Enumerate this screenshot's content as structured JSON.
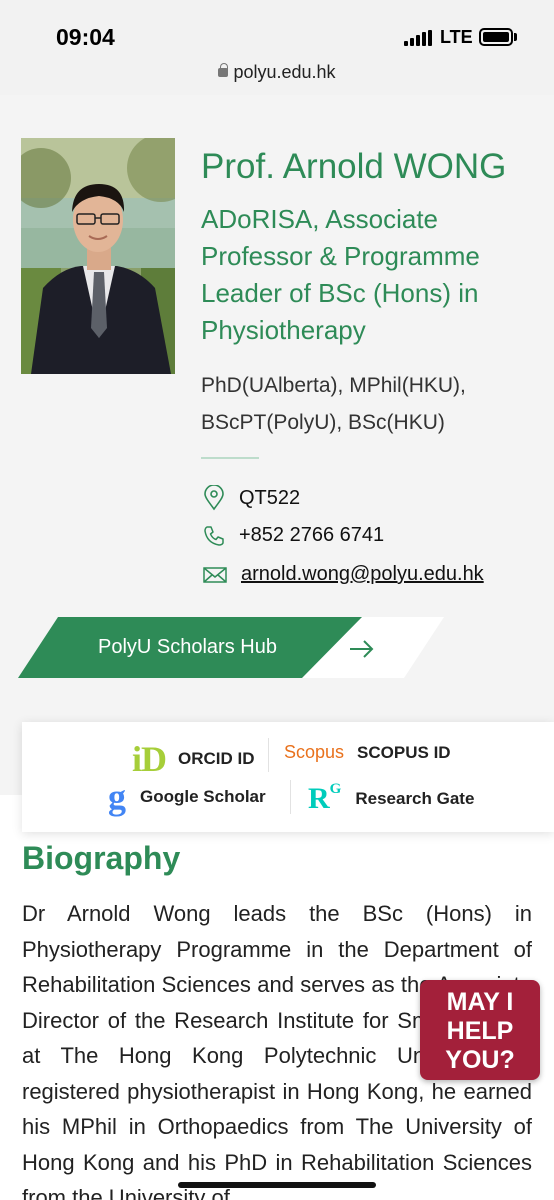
{
  "status_bar": {
    "time": "09:04",
    "network": "LTE"
  },
  "browser": {
    "url": "polyu.edu.hk"
  },
  "profile": {
    "name": "Prof. Arnold WONG",
    "role": "ADoRISA, Associate Professor & Programme Leader of BSc (Hons) in Physiotherapy",
    "degrees": "PhD(UAlberta), MPhil(HKU), BScPT(PolyU), BSc(HKU)",
    "room": "QT522",
    "phone": "+852 2766 6741",
    "email": "arnold.wong@polyu.edu.hk",
    "scholars_hub_label": "PolyU Scholars Hub",
    "accent_color": "#2e8b57"
  },
  "links": {
    "orcid_logo": "iD",
    "orcid_label": "ORCID ID",
    "scopus_logo": "Scopus",
    "scopus_label": "SCOPUS ID",
    "google_logo": "g",
    "google_label": "Google Scholar",
    "rg_logo": "R",
    "rg_logo_sup": "G",
    "rg_label": "Research Gate"
  },
  "biography": {
    "title": "Biography",
    "text": "Dr Arnold Wong leads the BSc (Hons) in Physiotherapy Programme in the Department of Rehabilitation Sciences and serves as the Associate Director of the Research Institute for Smart Ageing at The Hong Kong Polytechnic University. A registered physiotherapist in Hong Kong, he earned his MPhil in Orthopaedics from The University of Hong Kong and his PhD in Rehabilitation Sciences from the University of"
  },
  "chat_widget": {
    "line1": "MAY I",
    "line2": "HELP",
    "line3": "YOU?",
    "color": "#a3203a"
  }
}
